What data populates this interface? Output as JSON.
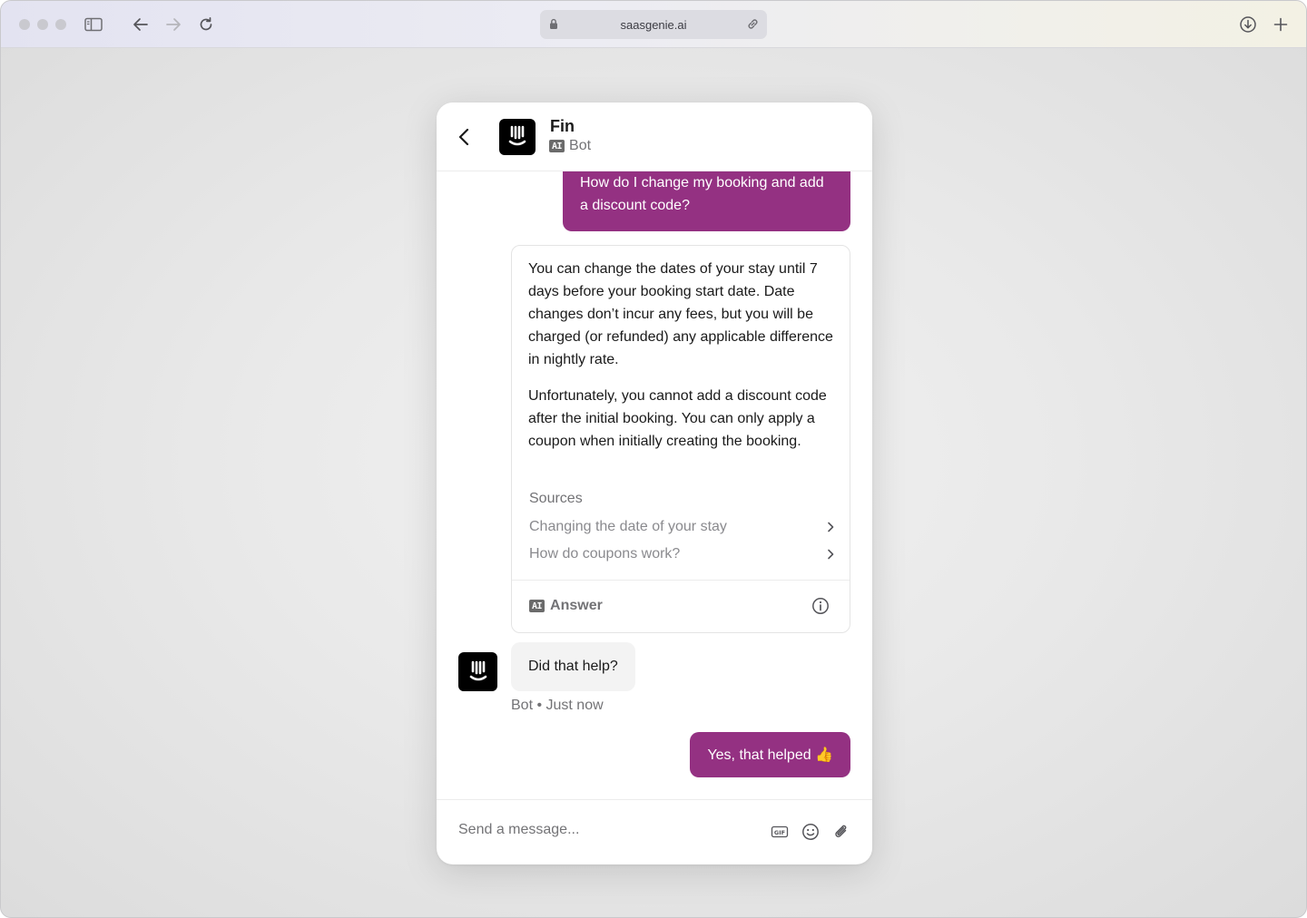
{
  "browser": {
    "url": "saasgenie.ai"
  },
  "messenger": {
    "header": {
      "name": "Fin",
      "badge": "AI",
      "role": "Bot"
    },
    "user_message_1": "How do I change my booking and add a discount code?",
    "answer": {
      "paragraph_1": "You can change the dates of your stay until 7 days before your booking start date. Date changes don’t incur any fees, but you will be charged (or refunded) any applicable difference in nightly rate.",
      "paragraph_2": "Unfortunately, you cannot add a discount code after the initial booking. You can only apply a coupon when initially creating the booking.",
      "sources_title": "Sources",
      "sources": [
        {
          "label": "Changing the date of your stay"
        },
        {
          "label": "How do coupons work?"
        }
      ],
      "footer_badge": "AI",
      "footer_label": "Answer"
    },
    "bot_message": "Did that help?",
    "bot_meta": "Bot • Just now",
    "user_message_2": "Yes, that helped 👍",
    "composer": {
      "placeholder": "Send a message...",
      "gif_label": "GIF"
    },
    "colors": {
      "brand": "#943182",
      "avatar": "#000000"
    }
  }
}
